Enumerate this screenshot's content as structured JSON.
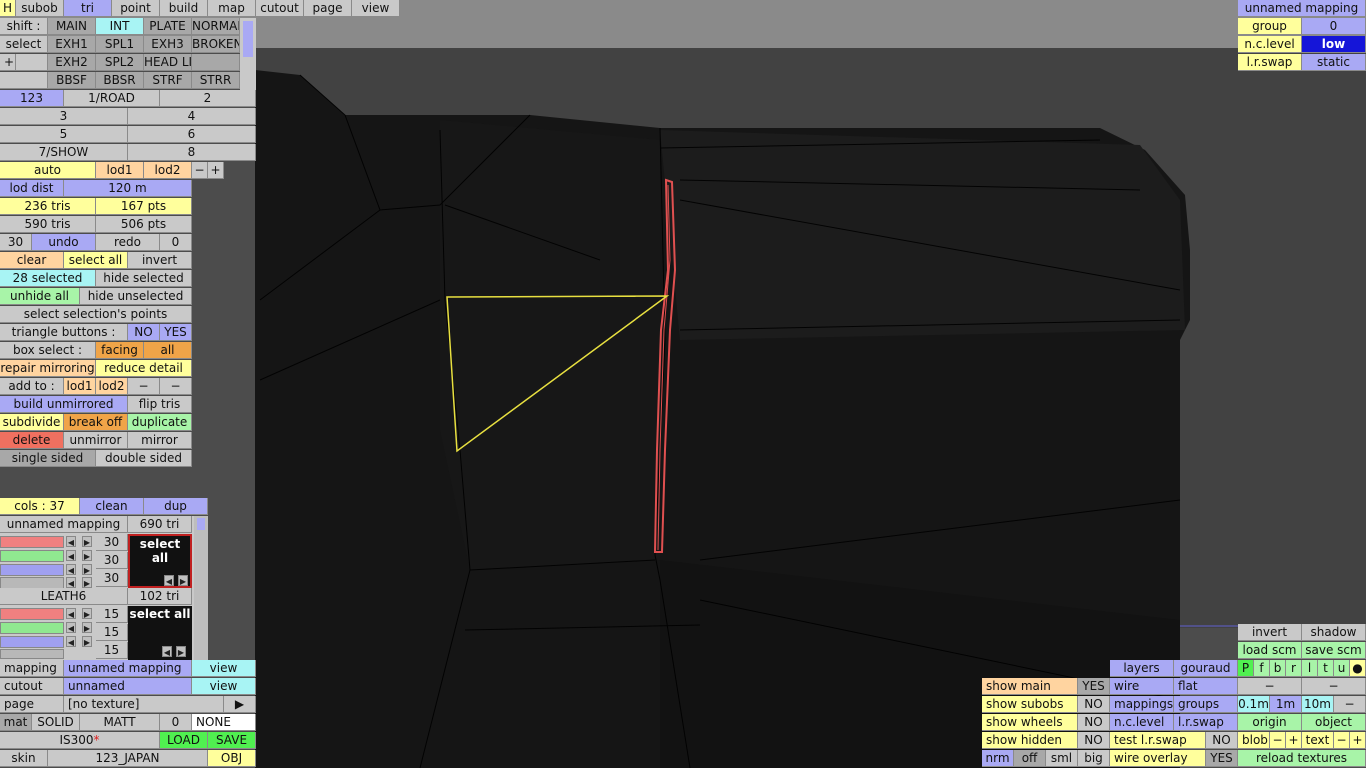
{
  "menu": {
    "h": "H",
    "tabs": [
      "subob",
      "tri",
      "point",
      "build",
      "map",
      "cutout",
      "page",
      "view"
    ]
  },
  "shift_grid": {
    "row1": [
      "shift :",
      "MAIN",
      "INT",
      "PLATE",
      "NORMAL"
    ],
    "row2": [
      "select",
      "EXH1",
      "SPL1",
      "EXH3",
      "BROKEN"
    ],
    "row3": [
      "+",
      "",
      "EXH2",
      "SPL2",
      "HEAD LI"
    ],
    "row4": [
      "BBSF",
      "BBSR",
      "STRF",
      "STRR"
    ]
  },
  "groups": {
    "row1": [
      "123",
      "1/ROAD",
      "2"
    ],
    "row2": [
      "3",
      "4"
    ],
    "row3": [
      "5",
      "6"
    ],
    "row4": [
      "7/SHOW",
      "8"
    ]
  },
  "lod": {
    "auto": "auto",
    "lod1": "lod1",
    "lod2": "lod2",
    "minus": "−",
    "plus": "+",
    "dist_label": "lod dist",
    "dist_value": "120 m"
  },
  "stats": {
    "tris1": "236 tris",
    "pts1": "167 pts",
    "tris2": "590 tris",
    "pts2": "506 pts"
  },
  "undo": {
    "count": "30",
    "undo": "undo",
    "redo": "redo",
    "redo_count": "0"
  },
  "selection": {
    "clear": "clear",
    "select_all": "select all",
    "invert": "invert",
    "selected": "28 selected",
    "hide_selected": "hide selected",
    "unhide_all": "unhide all",
    "hide_unselected": "hide unselected",
    "select_points": "select selection's points",
    "tri_buttons": "triangle buttons :",
    "no": "NO",
    "yes": "YES",
    "box_select": "box select :",
    "facing": "facing",
    "all": "all",
    "repair": "repair mirroring",
    "reduce": "reduce detail",
    "add_to": "add to :",
    "add_lod1": "lod1",
    "add_lod2": "lod2",
    "dash1": "−",
    "dash2": "−",
    "build_unmirrored": "build unmirrored",
    "flip_tris": "flip tris",
    "subdivide": "subdivide",
    "break_off": "break off",
    "duplicate": "duplicate",
    "delete": "delete",
    "unmirror": "unmirror",
    "mirror": "mirror",
    "single": "single sided",
    "double": "double sided"
  },
  "cols": {
    "label": "cols : 37",
    "clean": "clean",
    "dup": "dup"
  },
  "mat1": {
    "name": "unnamed mapping",
    "tris": "690 tri",
    "r": "30",
    "g": "30",
    "b": "30",
    "select_all": "select all"
  },
  "mat2": {
    "name": "LEATH6",
    "tris": "102 tri",
    "r": "15",
    "g": "15",
    "b": "15",
    "select_all": "select all"
  },
  "bottom": {
    "mapping_label": "mapping",
    "mapping_value": "unnamed mapping",
    "view1": "view",
    "cutout_label": "cutout",
    "cutout_value": "unnamed",
    "view2": "view",
    "page_label": "page",
    "page_value": "[no texture]",
    "arrow": "▶",
    "mat": "mat",
    "solid": "SOLID",
    "matt": "MATT",
    "zero": "0",
    "none": "NONE",
    "file": "IS300",
    "modified": "*",
    "load": "LOAD",
    "save": "SAVE",
    "skin": "skin",
    "skin_value": "123_JAPAN",
    "obj": "OBJ"
  },
  "top_right": {
    "title": "unnamed mapping",
    "group": "group",
    "group_val": "0",
    "ncl": "n.c.level",
    "ncl_val": "low",
    "lrs": "l.r.swap",
    "lrs_val": "static"
  },
  "bottom_right": {
    "invert": "invert",
    "shadow": "shadow",
    "load_scm": "load scm",
    "save_scm": "save scm",
    "layers": "layers",
    "gouraud": "gouraud",
    "letters": [
      "P",
      "f",
      "b",
      "r",
      "l",
      "t",
      "u",
      "●"
    ],
    "wire": "wire",
    "flat": "flat",
    "d1": "−",
    "d2": "−",
    "show_main": "show main",
    "yes1": "YES",
    "mappings": "mappings",
    "groups": "groups",
    "g01": "0.1m",
    "g1": "1m",
    "g10": "10m",
    "gm": "−",
    "show_subobs": "show subobs",
    "no1": "NO",
    "ncl": "n.c.level",
    "lrs": "l.r.swap",
    "origin": "origin",
    "object": "object",
    "show_wheels": "show wheels",
    "no2": "NO",
    "test_lrs": "test l.r.swap",
    "no4": "NO",
    "blob": "blob",
    "bm": "−",
    "bp": "+",
    "text": "text",
    "tm": "−",
    "tp": "+",
    "show_hidden": "show hidden",
    "no3": "NO",
    "nrm": "nrm",
    "off": "off",
    "sml": "sml",
    "big": "big",
    "wire_overlay": "wire overlay",
    "yes2": "YES",
    "reload": "reload textures"
  },
  "colors": {
    "selected_edges": "#e05050",
    "selected_tri": "#e8e040",
    "panel": "#c9c9c9",
    "blue": "#a9a9f4",
    "dark_blue": "#1515d8"
  }
}
